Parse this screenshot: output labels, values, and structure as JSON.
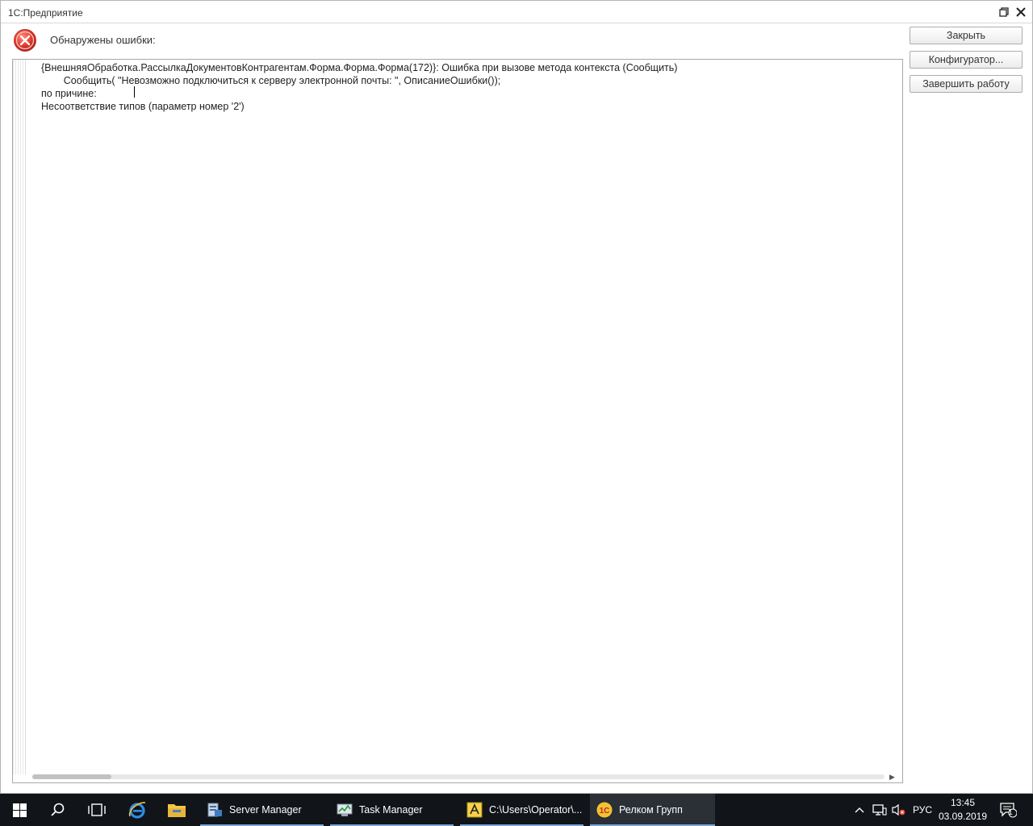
{
  "window": {
    "title": "1С:Предприятие",
    "restore_icon": "restore-icon",
    "close_icon": "close-icon"
  },
  "header": {
    "text": "Обнаружены ошибки:",
    "icon": "error-icon"
  },
  "message": {
    "lines": [
      "{ВнешняяОбработка.РассылкаДокументовКонтрагентам.Форма.Форма.Форма(172)}: Ошибка при вызове метода контекста (Сообщить)",
      "        Сообщить( \"Невозможно подключиться к серверу электронной почты: \", ОписаниеОшибки());",
      "по причине:",
      "Несоответствие типов (параметр номер '2')"
    ]
  },
  "buttons": {
    "close": "Закрыть",
    "configurator": "Конфигуратор...",
    "exit": "Завершить работу"
  },
  "taskbar": {
    "apps": [
      {
        "label": "Server Manager",
        "icon": "server-manager-icon"
      },
      {
        "label": "Task Manager",
        "icon": "task-manager-icon"
      },
      {
        "label": "C:\\Users\\Operator\\...",
        "icon": "explorer-path-icon"
      },
      {
        "label": "Релком Групп",
        "icon": "1c-icon"
      }
    ],
    "language": "РУС",
    "time": "13:45",
    "date": "03.09.2019",
    "notification_count": "1"
  }
}
